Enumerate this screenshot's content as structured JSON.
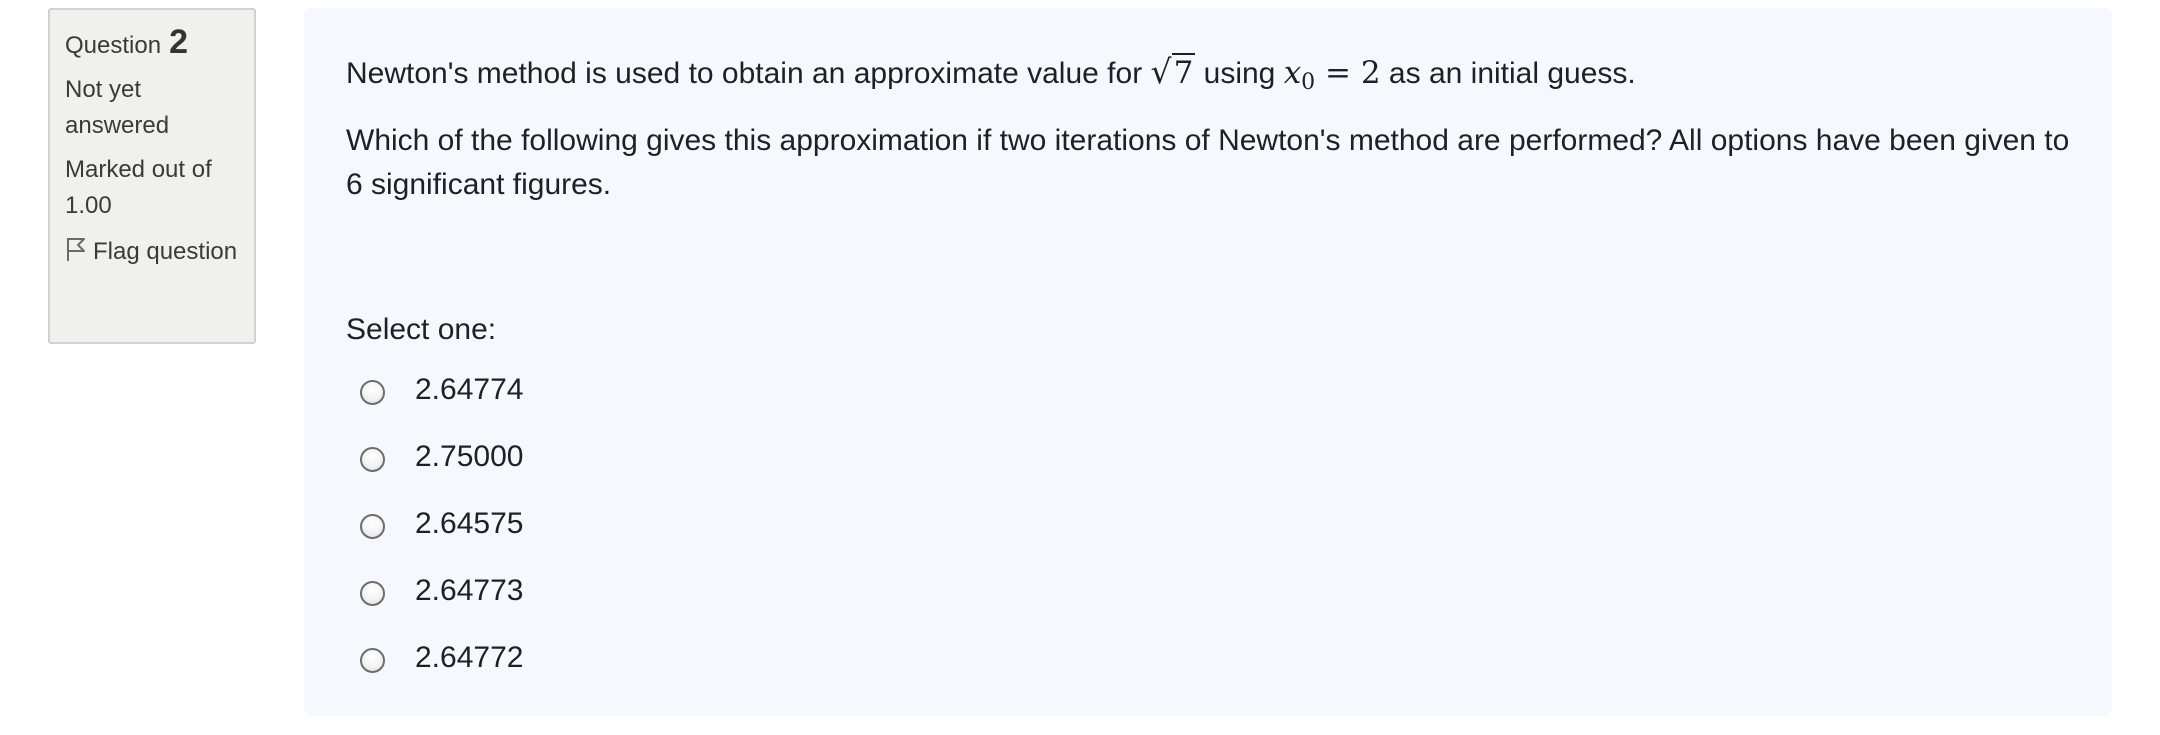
{
  "info": {
    "question_word": "Question",
    "question_number": "2",
    "state": "Not yet answered",
    "marked": "Marked out of 1.00",
    "flag_label": "Flag question"
  },
  "question": {
    "line1_before": "Newton's method  is used to obtain an approximate value for ",
    "sqrt_arg": "7",
    "line1_using": " using ",
    "var": "x",
    "var_sub": "0",
    "equals": " = ",
    "initial_value": "2",
    "line1_after": " as an initial guess.",
    "line2": "Which of the following gives this approximation if two iterations of Newton's method are performed? All options have been given to 6 significant figures."
  },
  "select_label": "Select one:",
  "options": [
    {
      "label": "2.64774"
    },
    {
      "label": "2.75000"
    },
    {
      "label": "2.64575"
    },
    {
      "label": "2.64773"
    },
    {
      "label": "2.64772"
    }
  ]
}
